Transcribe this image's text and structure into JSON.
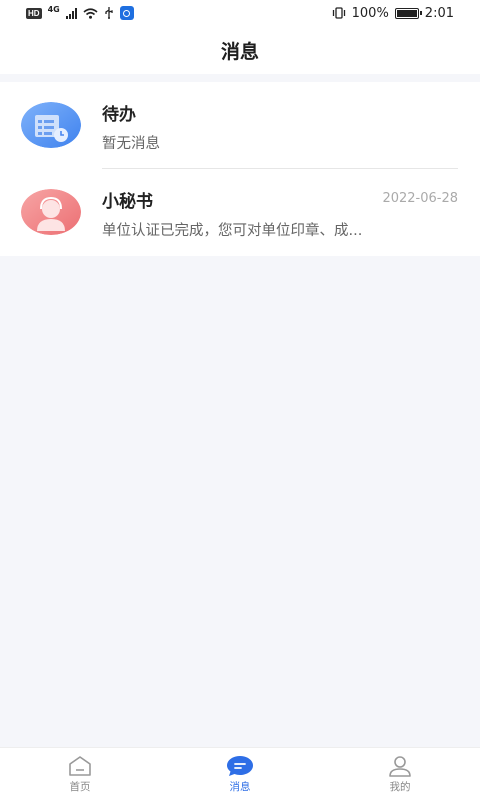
{
  "status_bar": {
    "hd": "HD",
    "network": "4G",
    "battery_percent": "100%",
    "time": "2:01"
  },
  "header": {
    "title": "消息"
  },
  "messages": [
    {
      "title": "待办",
      "subtitle": "暂无消息",
      "date": "",
      "avatar_icon": "todo-document-icon",
      "avatar_color": "#5b9af5"
    },
    {
      "title": "小秘书",
      "subtitle": "单位认证已完成，您可对单位印章、成...",
      "date": "2022-06-28",
      "avatar_icon": "secretary-person-icon",
      "avatar_color": "#f08a8a"
    }
  ],
  "tabbar": {
    "tabs": [
      {
        "label": "首页",
        "icon": "home-icon",
        "active": false
      },
      {
        "label": "消息",
        "icon": "message-bubble-icon",
        "active": true
      },
      {
        "label": "我的",
        "icon": "user-icon",
        "active": false
      }
    ],
    "active_color": "#2e6ee6"
  }
}
